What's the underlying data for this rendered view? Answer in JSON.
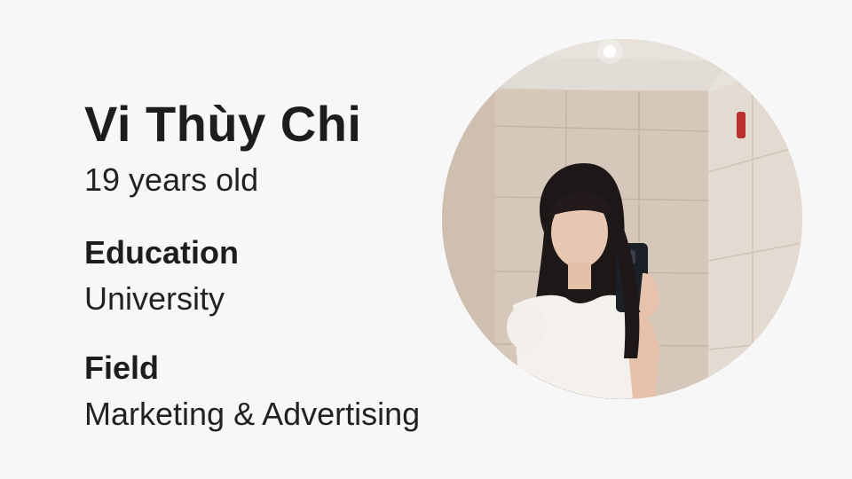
{
  "profile": {
    "name": "Vi Thùy Chi",
    "age": "19 years old",
    "education_label": "Education",
    "education_value": "University",
    "field_label": "Field",
    "field_value": "Marketing & Advertising"
  },
  "avatar": {
    "icon": "profile-photo"
  }
}
